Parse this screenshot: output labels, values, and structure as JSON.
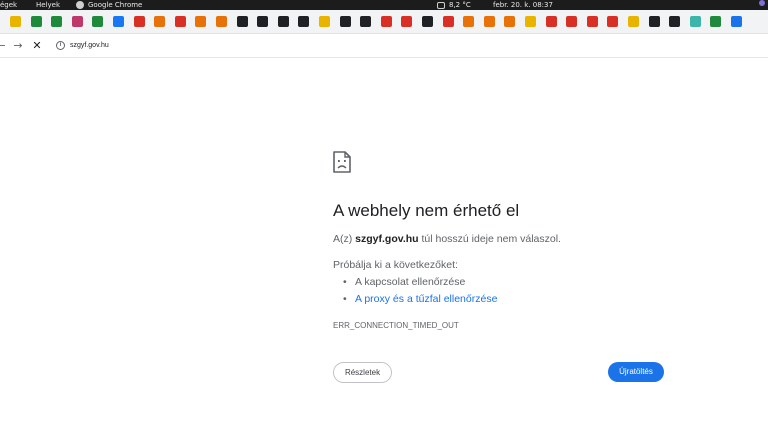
{
  "system_bar": {
    "activities": "égek",
    "places": "Helyek",
    "app": "Google Chrome",
    "temperature": "8,2 °C",
    "clock": "febr. 20. k.  08:37"
  },
  "bookmarks": {
    "colors": [
      "#e8b400",
      "#1f8a3b",
      "#1f8a3b",
      "#c0386b",
      "#1f8a3b",
      "#1877f2",
      "#d93025",
      "#e8710a",
      "#d93025",
      "#e8710a",
      "#e8710a",
      "#202124",
      "#202124",
      "#202124",
      "#202124",
      "#e8b400",
      "#202124",
      "#202124",
      "#d93025",
      "#d93025",
      "#202124",
      "#d93025",
      "#e8710a",
      "#e8710a",
      "#e8710a",
      "#e8b400",
      "#d93025",
      "#d93025",
      "#d93025",
      "#d93025",
      "#e8b400",
      "#202124",
      "#202124",
      "#3bb6a8",
      "#1f8a3b",
      "#1a73e8"
    ]
  },
  "navigation": {
    "url": "szgyf.gov.hu"
  },
  "error": {
    "title": "A webhely nem érhető el",
    "message_prefix": "A(z) ",
    "domain": "szgyf.gov.hu",
    "message_suffix": " túl hosszú ideje nem válaszol.",
    "try_heading": "Próbálja ki a következőket:",
    "suggestions": [
      "A kapcsolat ellenőrzése",
      "A proxy és a tűzfal ellenőrzése"
    ],
    "code": "ERR_CONNECTION_TIMED_OUT",
    "details_label": "Részletek",
    "reload_label": "Újratöltés"
  },
  "colors": {
    "accent": "#1a73e8",
    "title_text": "#202124",
    "body_text": "#5f6368"
  }
}
